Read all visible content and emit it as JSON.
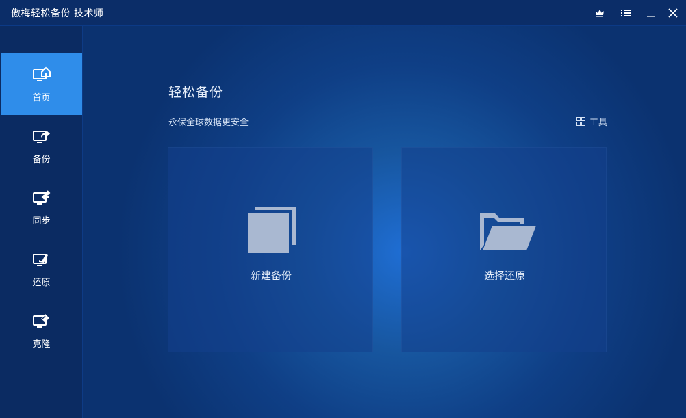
{
  "window": {
    "title": "傲梅轻松备份 技术师",
    "controls": [
      "crown-icon",
      "menu-icon",
      "minimize-icon",
      "close-icon"
    ]
  },
  "sidebar": {
    "items": [
      {
        "label": "首页",
        "icon": "home-monitor-icon",
        "active": true
      },
      {
        "label": "备份",
        "icon": "backup-monitor-icon",
        "active": false
      },
      {
        "label": "同步",
        "icon": "sync-monitor-icon",
        "active": false
      },
      {
        "label": "还原",
        "icon": "restore-monitor-icon",
        "active": false
      },
      {
        "label": "克隆",
        "icon": "clone-monitor-icon",
        "active": false
      }
    ]
  },
  "main": {
    "title": "轻松备份",
    "subtitle": "永保全球数据更安全",
    "tools_label": "工具",
    "cards": [
      {
        "label": "新建备份",
        "icon": "new-backup-icon"
      },
      {
        "label": "选择还原",
        "icon": "folder-open-icon"
      }
    ]
  },
  "colors": {
    "sidebar_bg": "#0b2b62",
    "active_nav": "#2f8dea",
    "card_bg": "#1b468c",
    "icon_gray": "#a9b8d1"
  }
}
